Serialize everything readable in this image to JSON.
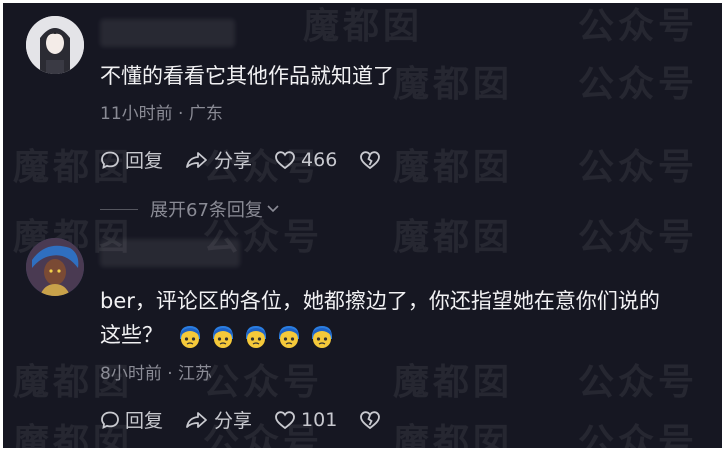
{
  "watermark": "魔都囡 公众号：魔都囡 公众号",
  "comments": [
    {
      "text": "不懂的看看它其他作品就知道了",
      "meta": "11小时前 · 广东",
      "reply_label": "回复",
      "share_label": "分享",
      "like_count": "466"
    },
    {
      "text_line1": "ber，评论区的各位，她都擦边了，你还指望她在意你们说的",
      "text_line2": "这些？",
      "meta": "8小时前 · 江苏",
      "reply_label": "回复",
      "share_label": "分享",
      "like_count": "101"
    }
  ],
  "expand_label": "展开67条回复",
  "colors": {
    "background": "#161722",
    "text": "#f1f1f3",
    "muted": "#8a8b95"
  }
}
